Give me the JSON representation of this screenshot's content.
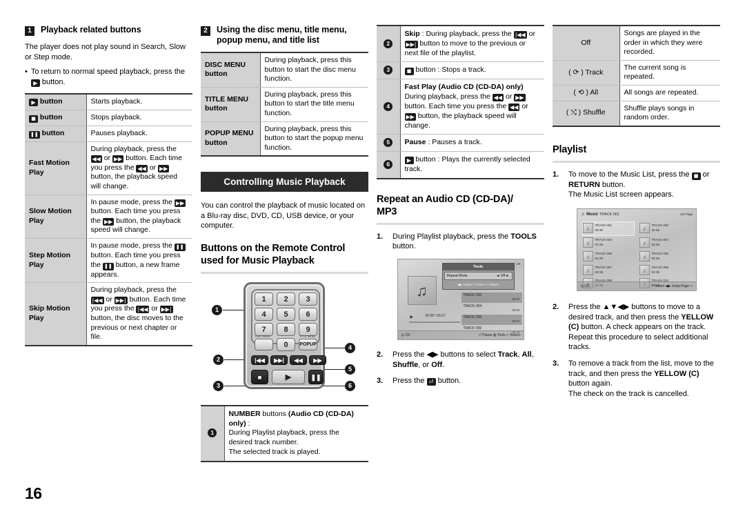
{
  "page": {
    "number": "16"
  },
  "col1": {
    "section": {
      "num": "1",
      "title": "Playback related buttons"
    },
    "intro": "The player does not play sound in Search, Slow or Step mode.",
    "bullet_dot": "•",
    "bullet_pre": "To return to normal speed playback, press the",
    "bullet_glyph": "▶",
    "bullet_post": "button.",
    "table": [
      {
        "key_glyph": "▶",
        "key_label": "button",
        "value": "Starts playback."
      },
      {
        "key_glyph": "■",
        "key_label": "button",
        "value": "Stops playback."
      },
      {
        "key_glyph": "❚❚",
        "key_label": "button",
        "value": "Pauses playback."
      },
      {
        "key_glyph": "",
        "key_label": "Fast Motion Play",
        "value_parts": [
          "During playback, press the",
          "◀◀",
          "or",
          "▶▶",
          "button.",
          "Each time you press the",
          "◀◀",
          "or",
          "▶▶",
          "button, the playback speed will change."
        ]
      },
      {
        "key_glyph": "",
        "key_label": "Slow Motion Play",
        "value_parts": [
          "In pause mode, press the",
          "▶▶",
          "button.",
          "Each time you press the",
          "▶▶",
          "button, the playback speed will change."
        ]
      },
      {
        "key_glyph": "",
        "key_label": "Step Motion Play",
        "value_parts": [
          "In pause mode, press the",
          "❚❚",
          "button.",
          "Each time you press the",
          "❚❚",
          "button, a new frame appears."
        ]
      },
      {
        "key_glyph": "",
        "key_label": "Skip Motion Play",
        "value_parts": [
          "During playback, press the",
          "|◀◀",
          "or",
          "▶▶|",
          "button.",
          "Each time you press the",
          "|◀◀",
          "or",
          "▶▶|",
          "button, the disc moves to the previous or next chapter or file."
        ]
      }
    ]
  },
  "col2": {
    "section": {
      "num": "2",
      "title_line1": "Using the disc menu, title menu,",
      "title_line2": "popup menu, and title list"
    },
    "table": [
      {
        "key_line1": "DISC MENU",
        "key_line2": "button",
        "value": "During playback, press this button to start the disc menu function."
      },
      {
        "key_line1": "TITLE MENU",
        "key_line2": "button",
        "value": "During playback, press this button to start the title menu function."
      },
      {
        "key_line1": "POPUP MENU",
        "key_line2": "button",
        "value": "During playback, press this button to start the popup menu function."
      }
    ],
    "band": "Controlling Music Playback",
    "intro": "You can control the playback of music located on a Blu-ray disc, DVD, CD, USB device, or your computer.",
    "subhead_line1": "Buttons on the Remote Control",
    "subhead_line2": "used for Music Playback",
    "remote": {
      "keys": [
        "1",
        "2",
        "3",
        "4",
        "5",
        "6",
        "7",
        "8",
        "9",
        "0"
      ],
      "disc_menu_label": "DISC MENU",
      "title_menu_label": "TITLE MENU",
      "popup_label": "POPUP",
      "prev_glyph": "|◀◀",
      "next_glyph": "▶▶|",
      "rew_glyph": "◀◀",
      "ff_glyph": "▶▶",
      "stop_glyph": "■",
      "play_glyph": "▶",
      "pause_glyph": "❚❚",
      "callouts": [
        "1",
        "2",
        "3",
        "4",
        "5",
        "6"
      ]
    },
    "callout_table": [
      {
        "num": "1",
        "bold1": "NUMBER",
        "mid1": " buttons ",
        "bold2": "(Audio CD (CD-DA) only)",
        "mid2": " :",
        "line2": "During Playlist playback, press the desired track number.",
        "line3": "The selected track is played."
      }
    ]
  },
  "col3": {
    "callout_table": [
      {
        "num": "2",
        "bold": "Skip",
        "text_parts": [
          " : During playback, press the",
          "|◀◀",
          "or",
          "▶▶|",
          "button to move to the previous or next file of the playlist."
        ]
      },
      {
        "num": "3",
        "glyph": "■",
        "text": "button : Stops a track."
      },
      {
        "num": "4",
        "bold": "Fast Play (Audio CD (CD-DA) only)",
        "text_parts": [
          "During playback, press the",
          "◀◀",
          "or",
          "▶▶",
          "button.",
          "Each time you press the",
          "◀◀",
          "or",
          "▶▶",
          "button, the playback speed will change."
        ]
      },
      {
        "num": "5",
        "bold": "Pause",
        "text": " : Pauses a track."
      },
      {
        "num": "6",
        "glyph": "▶",
        "text": "button : Plays the currently selected track."
      }
    ],
    "subhead_line1": "Repeat an Audio CD (CD-DA)/",
    "subhead_line2": "MP3",
    "steps": [
      {
        "n": "1.",
        "pre": "During Playlist playback, press the ",
        "bold": "TOOLS",
        "post": " button."
      },
      {
        "n": "2.",
        "pre": "Press the ◀▶ buttons to select ",
        "bold": "Track",
        "post": ", ",
        "bold2": "All",
        "post2": ", ",
        "bold3": "Shuffle",
        "post3": ", or ",
        "bold4": "Off",
        "post4": "."
      },
      {
        "n": "3.",
        "pre": "Press the ",
        "glyph": "⏎",
        "post": " button."
      }
    ],
    "screenshot": {
      "track_label": "TRACK 001",
      "timecode": "00:08 / 05:57",
      "page_indicator": "1/6",
      "tools_title": "Tools",
      "tools_option_label": "Repeat Mode",
      "tools_option_value": "Off",
      "tools_footer": "◀▶ Adjust   ⏎ Select   ↩ Return",
      "rows": [
        {
          "name": "TRACK 003",
          "time": "04:07",
          "selected": true
        },
        {
          "name": "TRACK 004",
          "time": "03:41",
          "selected": false
        },
        {
          "name": "TRACK 005",
          "time": "03:17",
          "selected": true
        },
        {
          "name": "TRACK 006",
          "time": "05:16",
          "selected": false
        }
      ],
      "footer_left": "CD",
      "footer_right": "⏎ Pause    ▤ Tools    ↩ Return"
    }
  },
  "col4": {
    "repeat_table": [
      {
        "mode": "Off",
        "desc": "Songs are played in the order in which they were recorded."
      },
      {
        "mode": "( ⟳ ) Track",
        "desc": "The current song is repeated."
      },
      {
        "mode": "( ⟲ ) All",
        "desc": "All songs are repeated."
      },
      {
        "mode": "( ⤭ ) Shuffle",
        "desc": "Shuffle plays songs in random order."
      }
    ],
    "subhead": "Playlist",
    "steps": [
      {
        "n": "1.",
        "pre": "To move to the Music List, press the ",
        "glyph": "■",
        "mid": " or ",
        "bold": "RETURN",
        "post": " button.",
        "line2": "The Music List screen appears."
      },
      {
        "n": "2.",
        "pre": "Press the ▲▼◀▶ buttons to move to a desired track, and then press the ",
        "bold": "YELLOW (C)",
        "post": " button. A check appears on the track.",
        "line2": "Repeat this procedure to select additional tracks."
      },
      {
        "n": "3.",
        "pre": "To remove a track from the list, move to the track, and then press the ",
        "bold": "YELLOW",
        "post": "",
        "bold2": "(C)",
        "post2": " button again.",
        "line2": "The check on the track is cancelled."
      }
    ],
    "screenshot": {
      "header_title": "Music",
      "header_track": "TRACK 001",
      "page_indicator": "1/2 Page",
      "tracks": [
        {
          "name": "TRACK 001",
          "time": "02:35",
          "col": 0,
          "highlight": true
        },
        {
          "name": "TRACK 002",
          "time": "02:35",
          "col": 1,
          "highlight": false
        },
        {
          "name": "TRACK 003",
          "time": "02:35",
          "col": 0,
          "highlight": false
        },
        {
          "name": "TRACK 004",
          "time": "02:35",
          "col": 1,
          "highlight": false
        },
        {
          "name": "TRACK 005",
          "time": "02:35",
          "col": 0,
          "highlight": false
        },
        {
          "name": "TRACK 006",
          "time": "02:35",
          "col": 1,
          "highlight": false
        },
        {
          "name": "TRACK 007",
          "time": "02:35",
          "col": 0,
          "highlight": false
        },
        {
          "name": "TRACK 008",
          "time": "02:35",
          "col": 1,
          "highlight": false
        },
        {
          "name": "TRACK 009",
          "time": "02:35",
          "col": 0,
          "highlight": false
        },
        {
          "name": "TRACK 010",
          "time": "02:35",
          "col": 1,
          "highlight": false
        }
      ],
      "footer_left": "CD",
      "footer_right": "⏎ Select    ◀▶ Jump Page    ↩"
    }
  }
}
